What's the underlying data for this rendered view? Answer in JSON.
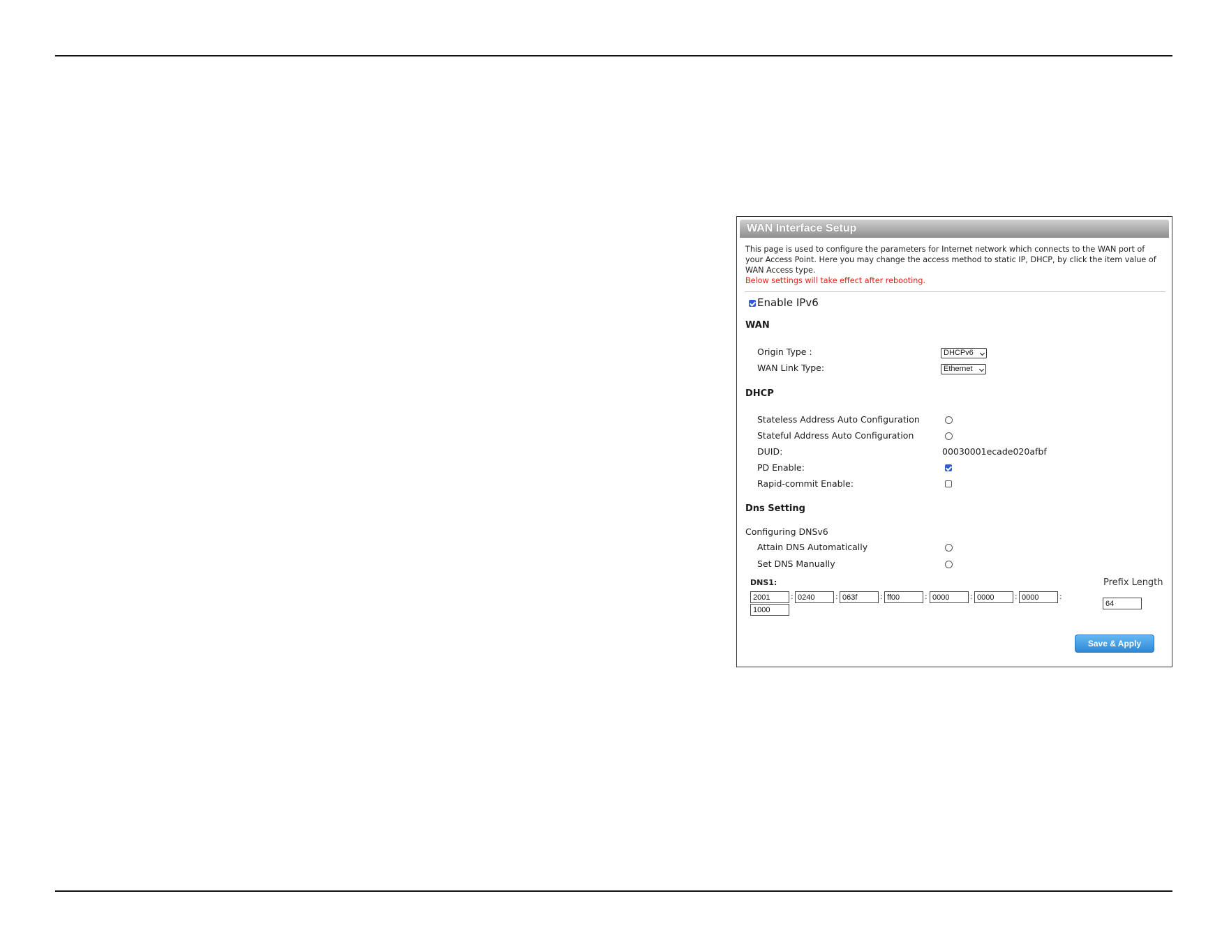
{
  "panel": {
    "title": "WAN Interface Setup",
    "description": "This page is used to configure the parameters for Internet network which connects to the WAN port of your Access Point. Here you may change the access method to static IP, DHCP, by click the item value of WAN Access type.",
    "warning": "Below settings will take effect after rebooting."
  },
  "ipv6": {
    "label": "Enable IPv6",
    "checked": true
  },
  "wan": {
    "section": "WAN",
    "origin_type_label": "Origin Type :",
    "origin_type_value": "DHCPv6",
    "link_type_label": "WAN Link Type:",
    "link_type_value": "Ethernet"
  },
  "dhcp": {
    "section": "DHCP",
    "stateless_label": "Stateless Address Auto Configuration",
    "stateful_label": "Stateful Address Auto Configuration",
    "duid_label": "DUID:",
    "duid_value": "00030001ecade020afbf",
    "pd_label": "PD Enable:",
    "pd_checked": true,
    "rapid_label": "Rapid-commit Enable:",
    "rapid_checked": false
  },
  "dns": {
    "section": "Dns Setting",
    "sub_section": "Configuring DNSv6",
    "auto_label": "Attain DNS Automatically",
    "manual_label": "Set DNS Manually",
    "dns1_label": "DNS1:",
    "dns1_segments": [
      "2001",
      "0240",
      "063f",
      "ff00",
      "0000",
      "0000",
      "0000",
      "1000"
    ],
    "prefix_label": "Prefix Length",
    "prefix_value": "64"
  },
  "save_button": "Save & Apply"
}
